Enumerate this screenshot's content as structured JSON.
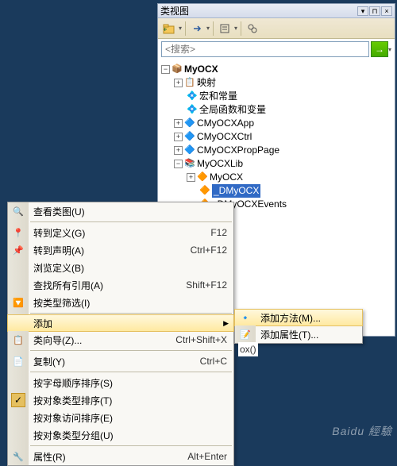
{
  "panel": {
    "title": "类视图"
  },
  "search": {
    "placeholder": "<搜索>"
  },
  "tree": {
    "root": "MyOCX",
    "n1": "映射",
    "n2": "宏和常量",
    "n3": "全局函数和变量",
    "n4": "CMyOCXApp",
    "n5": "CMyOCXCtrl",
    "n6": "CMyOCXPropPage",
    "n7": "MyOCXLib",
    "n7a": "MyOCX",
    "n7b": "_DMyOCX",
    "n7c": "_DMyOCXEvents"
  },
  "menu": {
    "m1": "查看类图(U)",
    "m2": "转到定义(G)",
    "s2": "F12",
    "m3": "转到声明(A)",
    "s3": "Ctrl+F12",
    "m4": "浏览定义(B)",
    "m5": "查找所有引用(A)",
    "s5": "Shift+F12",
    "m6": "按类型筛选(I)",
    "m7": "添加",
    "m8": "类向导(Z)...",
    "s8": "Ctrl+Shift+X",
    "m9": "复制(Y)",
    "s9": "Ctrl+C",
    "m10": "按字母顺序排序(S)",
    "m11": "按对象类型排序(T)",
    "m12": "按对象访问排序(E)",
    "m13": "按对象类型分组(U)",
    "m14": "属性(R)",
    "s14": "Alt+Enter"
  },
  "submenu": {
    "a1": "添加方法(M)...",
    "a2": "添加属性(T)..."
  },
  "bottomText": "ox()",
  "watermark": "Baidu 經驗"
}
